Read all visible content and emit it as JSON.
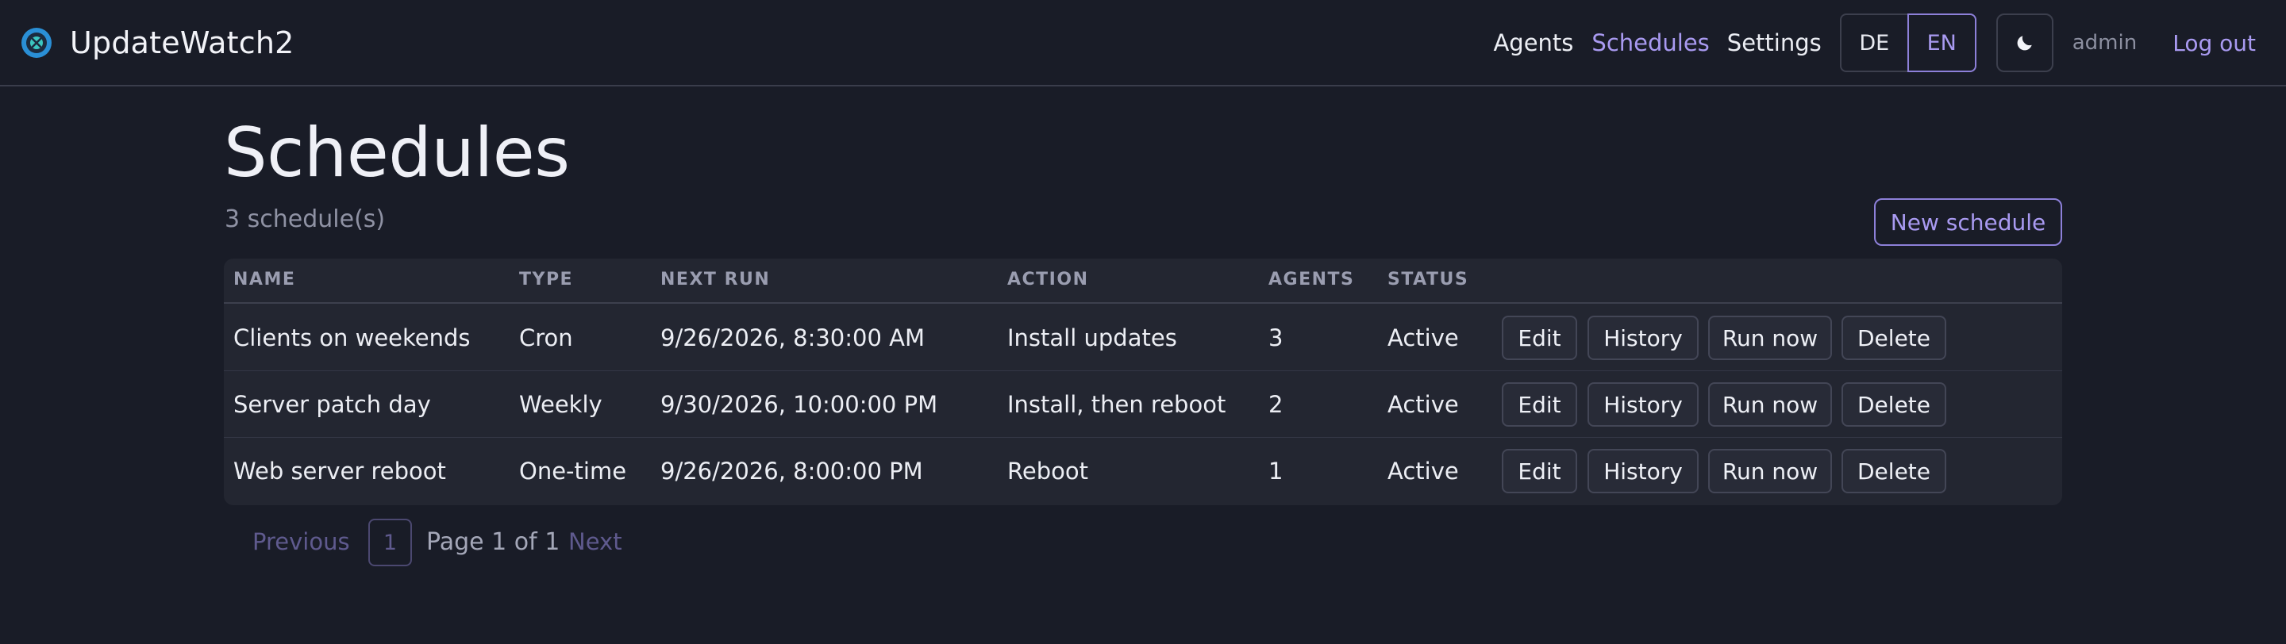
{
  "app": {
    "name": "UpdateWatch2",
    "icon": "logo-icon"
  },
  "nav": {
    "agents": "Agents",
    "schedules": "Schedules",
    "settings": "Settings",
    "active": "Schedules",
    "lang_de": "DE",
    "lang_en": "EN",
    "active_lang": "EN",
    "theme_icon": "moon-icon",
    "user": "admin",
    "logout": "Log out"
  },
  "page": {
    "title": "Schedules",
    "count": "3 schedule(s)",
    "new_button": "New schedule"
  },
  "table": {
    "headers": [
      "NAME",
      "TYPE",
      "NEXT RUN",
      "ACTION",
      "AGENTS",
      "STATUS"
    ],
    "rows": [
      {
        "name": "Clients on weekends",
        "type": "Cron",
        "next_run": "9/26/2026, 8:30:00 AM",
        "action": "Install updates",
        "agents": "3",
        "status": "Active"
      },
      {
        "name": "Server patch day",
        "type": "Weekly",
        "next_run": "9/30/2026, 10:00:00 PM",
        "action": "Install, then reboot",
        "agents": "2",
        "status": "Active"
      },
      {
        "name": "Web server reboot",
        "type": "One-time",
        "next_run": "9/26/2026, 8:00:00 PM",
        "action": "Reboot",
        "agents": "1",
        "status": "Active"
      }
    ],
    "row_actions": {
      "edit": "Edit",
      "history": "History",
      "run_now": "Run now",
      "delete": "Delete"
    }
  },
  "pagination": {
    "previous": "Previous",
    "current": "1",
    "info": "Page 1 of 1",
    "next": "Next"
  },
  "colors": {
    "background": "#191c27",
    "accent": "#a99af1",
    "table_bg": "#232631"
  }
}
